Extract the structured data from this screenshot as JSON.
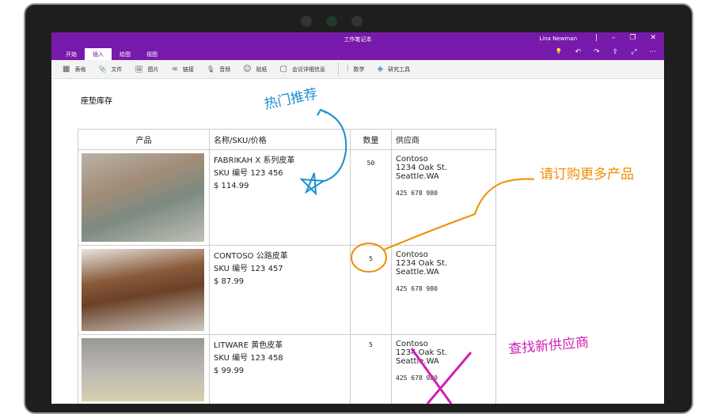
{
  "window": {
    "title": "工作笔记本",
    "user": "Lina Newman",
    "controls": [
      "|",
      "–",
      "❐",
      "✕"
    ]
  },
  "tabs": [
    {
      "label": "开始"
    },
    {
      "label": "插入",
      "active": true
    },
    {
      "label": "绘图"
    },
    {
      "label": "视图"
    }
  ],
  "actions": [
    "💡",
    "↶",
    "↷",
    "⇪",
    "⤢",
    "···"
  ],
  "ribbon": [
    {
      "icon": "table-icon",
      "glyph": "▦",
      "label": "表格"
    },
    {
      "icon": "paperclip-icon",
      "glyph": "📎",
      "label": "文件"
    },
    {
      "icon": "picture-icon",
      "glyph": "🖼",
      "label": "图片"
    },
    {
      "icon": "link-icon",
      "glyph": "∞",
      "label": "链接"
    },
    {
      "icon": "audio-icon",
      "glyph": "🎙",
      "label": "音频"
    },
    {
      "icon": "sticker-icon",
      "glyph": "☺",
      "label": "贴纸"
    },
    {
      "icon": "calendar-icon",
      "glyph": "▢",
      "label": "会议详细信息"
    },
    {
      "icon": "math-icon",
      "glyph": "⫶",
      "label": "数学"
    },
    {
      "icon": "research-icon",
      "glyph": "◈",
      "label": "研究工具"
    }
  ],
  "page": {
    "title": "座垫库存"
  },
  "table": {
    "headers": [
      "产品",
      "名称/SKU/价格",
      "数量",
      "供应商"
    ],
    "rows": [
      {
        "name": "FABRIKAH X 系列皮革",
        "sku": "SKU 编号 123 456",
        "price": "$ 114.99",
        "qty": "50",
        "supplier": "Contoso",
        "addr1": "1234 Oak St.",
        "addr2": "Seattle.WA",
        "phone": "425 678 980"
      },
      {
        "name": "CONTOSO 公路皮革",
        "sku": "SKU 编号 123 457",
        "price": "$ 87.99",
        "qty": "5",
        "supplier": "Contoso",
        "addr1": "1234 Oak St.",
        "addr2": "Seattle.WA",
        "phone": "425 678 980"
      },
      {
        "name": "LITWARE 黄色皮革",
        "sku": "SKU 编号 123 458",
        "price": "$ 99.99",
        "qty": "5",
        "supplier": "Contoso",
        "addr1": "1234 Oak St.",
        "addr2": "Seattle.WA",
        "phone": "425 678 980"
      }
    ]
  },
  "annotations": {
    "hot": "热门推荐",
    "reorder": "请订购更多产品",
    "newsupplier": "查找新供应商"
  },
  "colors": {
    "purple": "#7719aa",
    "blue": "#1a8fd0",
    "orange": "#f28c00",
    "magenta": "#d21fb4"
  }
}
